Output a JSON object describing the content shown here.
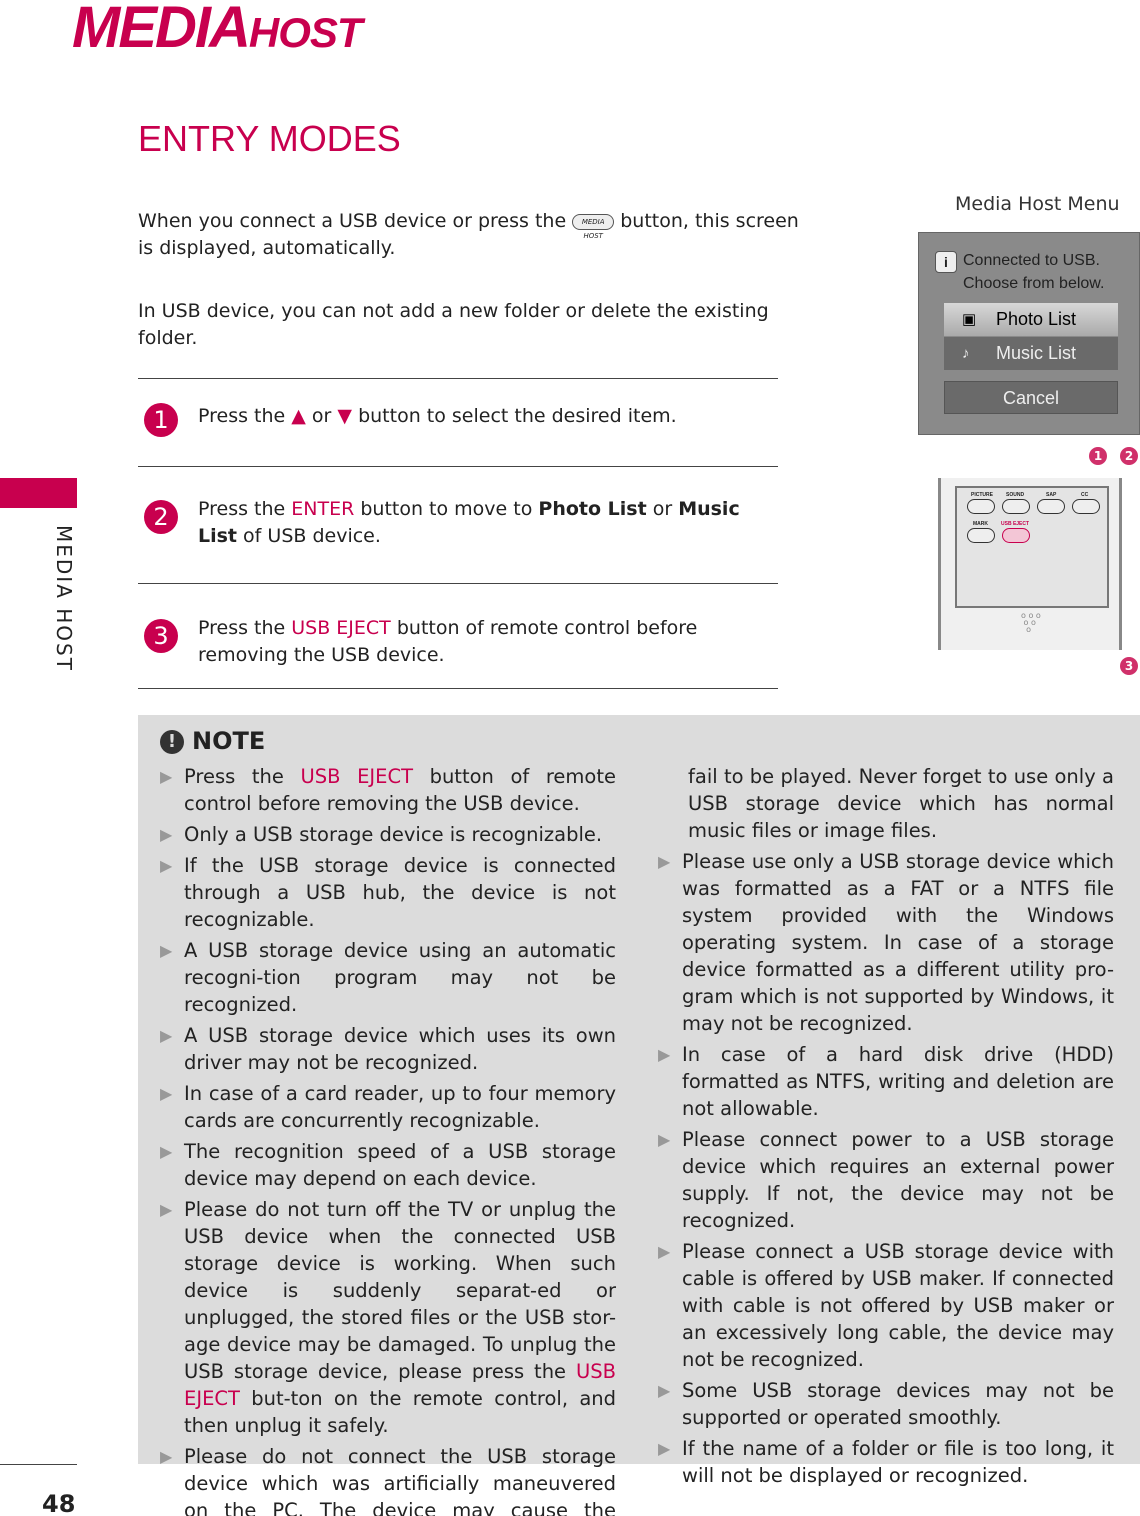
{
  "header": {
    "logo_big": "MEDIA",
    "logo_small": "HOST",
    "brand_color": "#c8004e"
  },
  "side_label": "MEDIA HOST",
  "page_number": "48",
  "title": "ENTRY MODES",
  "intro": {
    "p1_a": "When you connect a USB device or  press the ",
    "button_label": "MEDIA HOST",
    "p1_b": " button, this screen is displayed, automatically.",
    "p2": "In USB device, you can not add a new folder or delete the existing folder."
  },
  "steps": [
    {
      "num": "1",
      "parts": [
        {
          "t": "Press the "
        },
        {
          "t": "▲",
          "c": "red"
        },
        {
          "t": " or "
        },
        {
          "t": "▼",
          "c": "red"
        },
        {
          "t": " button to select the desired item."
        }
      ]
    },
    {
      "num": "2",
      "parts": [
        {
          "t": "Press the "
        },
        {
          "t": "ENTER",
          "c": "red"
        },
        {
          "t": " button to move to "
        },
        {
          "t": "Photo List",
          "c": "b"
        },
        {
          "t": " or "
        },
        {
          "t": "Music List",
          "c": "b"
        },
        {
          "t": " of USB device."
        }
      ]
    },
    {
      "num": "3",
      "parts": [
        {
          "t": "Press the "
        },
        {
          "t": "USB EJECT",
          "c": "red"
        },
        {
          "t": "  button of remote control before removing the USB device."
        }
      ]
    }
  ],
  "menu": {
    "caption": "Media Host Menu",
    "message_line1": "Connected to USB.",
    "message_line2": "Choose from below.",
    "items": [
      {
        "label": "Photo List",
        "icon": "photo-icon",
        "selected": true
      },
      {
        "label": "Music List",
        "icon": "music-note-icon",
        "selected": false
      }
    ],
    "cancel": "Cancel",
    "step_markers": [
      "1",
      "2",
      "3"
    ]
  },
  "remote": {
    "buttons": [
      "PICTURE",
      "SOUND",
      "SAP",
      "CC",
      "MARK",
      "USB EJECT"
    ]
  },
  "note": {
    "title": "NOTE",
    "left": [
      {
        "parts": [
          {
            "t": "Press the "
          },
          {
            "t": "USB EJECT",
            "c": "red"
          },
          {
            "t": "  button of remote control before removing the USB device."
          }
        ]
      },
      {
        "parts": [
          {
            "t": "Only a USB storage device is recognizable."
          }
        ]
      },
      {
        "parts": [
          {
            "t": "If the USB storage device is connected through a USB hub, the device is not recognizable."
          }
        ]
      },
      {
        "parts": [
          {
            "t": "A USB storage device using an automatic recogni-tion program may not be recognized."
          }
        ]
      },
      {
        "parts": [
          {
            "t": "A USB storage device which uses its own driver may not be recognized."
          }
        ]
      },
      {
        "parts": [
          {
            "t": "In case of a card reader, up to four memory cards are concurrently recognizable."
          }
        ]
      },
      {
        "parts": [
          {
            "t": "The recognition speed of a USB storage device may depend on each device."
          }
        ]
      },
      {
        "parts": [
          {
            "t": "Please do not turn off the TV or unplug the USB device when the connected USB storage device is working.  When such device is suddenly separat-ed or unplugged, the stored files or the USB stor-age device may be damaged.  To unplug the USB storage device, please press the "
          },
          {
            "t": "USB EJECT",
            "c": "red"
          },
          {
            "t": " but-ton on the remote control, and then unplug it safely."
          }
        ]
      },
      {
        "parts": [
          {
            "t": "Please do not connect the USB storage device which was artificially maneuvered on the PC.  The device may cause the product to malfunction or"
          }
        ]
      }
    ],
    "right": [
      {
        "cont": true,
        "parts": [
          {
            "t": "fail to be played.  Never forget to use only a USB storage device which has normal music files or image files."
          }
        ]
      },
      {
        "parts": [
          {
            "t": "Please use only a USB storage device which was formatted as a FAT or a NTFS file system provided with the Windows operating system.  In case of a storage device formatted as a different utility pro-gram which is not supported by Windows, it may not be recognized."
          }
        ]
      },
      {
        "parts": [
          {
            "t": "In case of a hard disk drive (HDD) formatted as NTFS, writing and deletion are not allowable."
          }
        ]
      },
      {
        "parts": [
          {
            "t": "Please connect power to a USB storage device which requires an external power supply.  If not, the device may not be recognized."
          }
        ]
      },
      {
        "parts": [
          {
            "t": "Please connect a USB storage device with cable is offered by USB maker.  If connected with cable is not offered by USB maker or an excessively long cable, the device may not be recognized."
          }
        ]
      },
      {
        "parts": [
          {
            "t": "Some USB storage devices may not be supported or operated smoothly."
          }
        ]
      },
      {
        "parts": [
          {
            "t": "If the name of a folder or file is too long, it will not be displayed or recognized."
          }
        ]
      }
    ]
  }
}
